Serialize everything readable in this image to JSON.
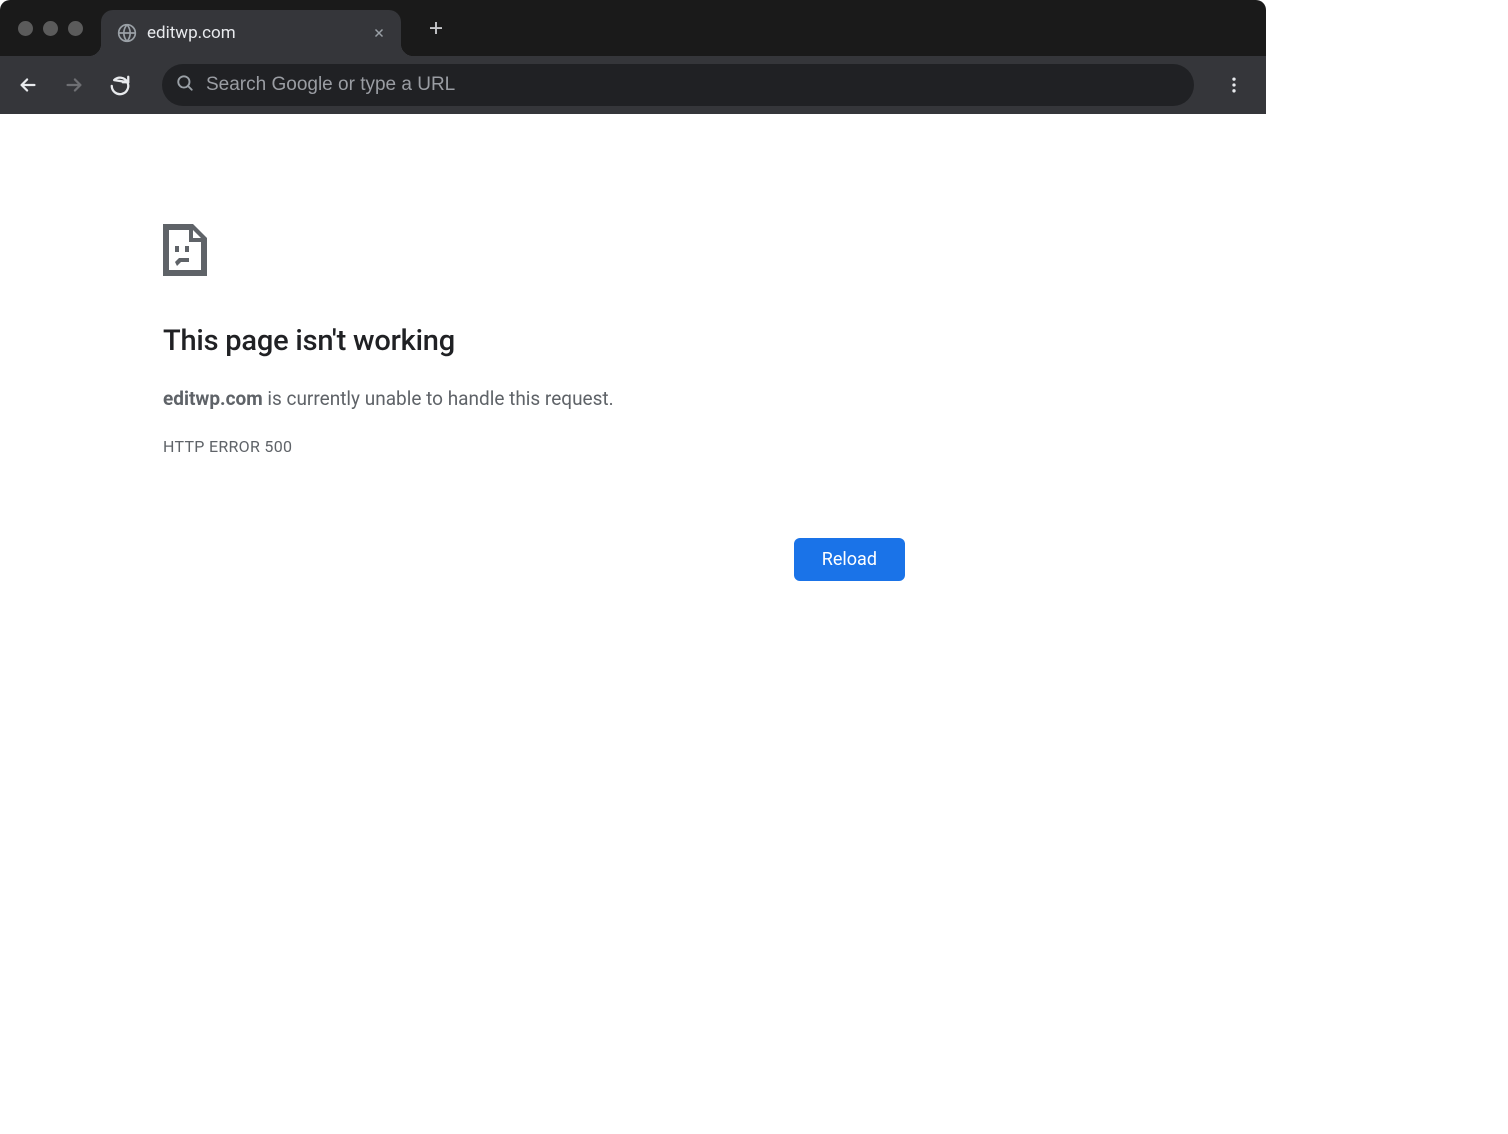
{
  "tab": {
    "title": "editwp.com"
  },
  "omnibox": {
    "placeholder": "Search Google or type a URL",
    "value": ""
  },
  "error": {
    "title": "This page isn't working",
    "domain": "editwp.com",
    "message": " is currently unable to handle this request.",
    "code": "HTTP ERROR 500"
  },
  "buttons": {
    "reload": "Reload"
  }
}
